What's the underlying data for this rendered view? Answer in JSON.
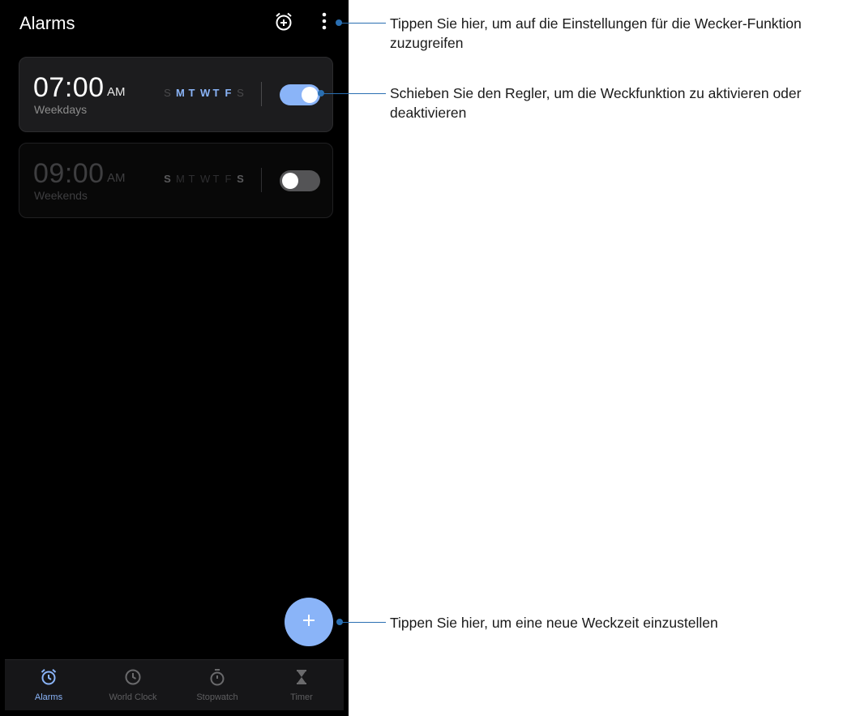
{
  "app": {
    "title": "Alarms"
  },
  "toolbar": {
    "icons": [
      "alarm-add-icon",
      "more-vert-icon"
    ]
  },
  "alarms": [
    {
      "time": "07:00",
      "ampm": "AM",
      "repeat": "Weekdays",
      "days": [
        "S",
        "M",
        "T",
        "W",
        "T",
        "F",
        "S"
      ],
      "active_days": [
        false,
        true,
        true,
        true,
        true,
        true,
        false
      ],
      "enabled": true
    },
    {
      "time": "09:00",
      "ampm": "AM",
      "repeat": "Weekends",
      "days": [
        "S",
        "M",
        "T",
        "W",
        "T",
        "F",
        "S"
      ],
      "active_days": [
        true,
        false,
        false,
        false,
        false,
        false,
        true
      ],
      "enabled": false
    }
  ],
  "fab": {
    "icon": "plus-icon"
  },
  "nav": [
    {
      "label": "Alarms",
      "icon": "alarm-icon",
      "active": true
    },
    {
      "label": "World Clock",
      "icon": "clock-icon",
      "active": false
    },
    {
      "label": "Stopwatch",
      "icon": "stopwatch-icon",
      "active": false
    },
    {
      "label": "Timer",
      "icon": "hourglass-icon",
      "active": false
    }
  ],
  "annotations": {
    "settings": "Tippen Sie hier, um auf die Einstellungen für die Wecker-Funktion zuzugreifen",
    "toggle": "Schieben Sie den Regler, um die Weckfunktion zu aktivieren oder deaktivieren",
    "add": "Tippen Sie hier, um eine neue Weckzeit einzustellen"
  },
  "colors": {
    "accent": "#8ab4f8",
    "callout": "#2a6fb2",
    "background": "#000000"
  }
}
